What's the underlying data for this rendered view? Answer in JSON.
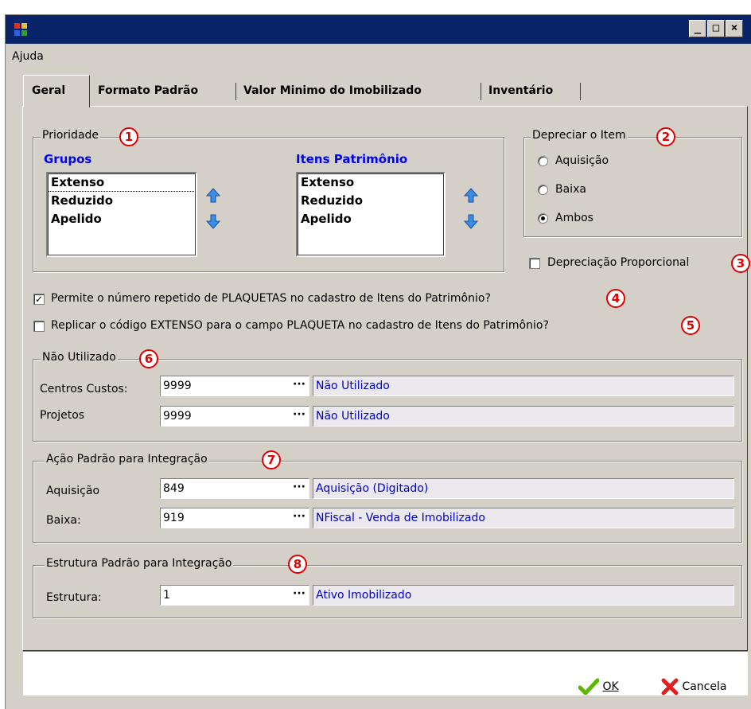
{
  "menu": {
    "help": "Ajuda"
  },
  "tabs": [
    "Geral",
    "Formato Padrão",
    "Valor Minimo do Imobilizado",
    "Inventário"
  ],
  "priority": {
    "title": "Prioridade",
    "badge": "1",
    "groups_title": "Grupos",
    "groups_items": [
      "Extenso",
      "Reduzido",
      "Apelido"
    ],
    "assets_title": "Itens Patrimônio",
    "assets_items": [
      "Extenso",
      "Reduzido",
      "Apelido"
    ]
  },
  "depreciate": {
    "title": "Depreciar o Item",
    "badge": "2",
    "options": [
      "Aquisição",
      "Baixa",
      "Ambos"
    ],
    "selected": "Ambos"
  },
  "proportional": {
    "label": "Depreciação Proporcional",
    "checked": false,
    "badge": "3"
  },
  "allow_repeat": {
    "label": "Permite o número repetido de PLAQUETAS no cadastro de Itens do Patrimônio?",
    "checked": true,
    "badge": "4"
  },
  "replicate": {
    "label": "Replicar o código EXTENSO para o campo PLAQUETA no cadastro de Itens do Patrimônio?",
    "checked": false,
    "badge": "5"
  },
  "not_used": {
    "title": "Não Utilizado",
    "badge": "6",
    "rows": [
      {
        "label": "Centros Custos:",
        "code": "9999",
        "desc": "Não Utilizado"
      },
      {
        "label": "Projetos",
        "code": "9999",
        "desc": "Não Utilizado"
      }
    ]
  },
  "default_action": {
    "title": "Ação Padrão para Integração",
    "badge": "7",
    "rows": [
      {
        "label": "Aquisição",
        "code": "849",
        "desc": "Aquisição (Digitado)"
      },
      {
        "label": "Baixa:",
        "code": "919",
        "desc": "NFiscal - Venda de Imobilizado"
      }
    ]
  },
  "default_structure": {
    "title": "Estrutura Padrão para Integração",
    "badge": "8",
    "rows": [
      {
        "label": "Estrutura:",
        "code": "1",
        "desc": "Ativo Imobilizado"
      }
    ]
  },
  "lookup_button": "···",
  "buttons": {
    "ok": "OK",
    "cancel": "Cancela"
  },
  "colors": {
    "titlebar": "#0a246a",
    "accent_blue": "#0000ff",
    "badge_red": "#e00000"
  }
}
